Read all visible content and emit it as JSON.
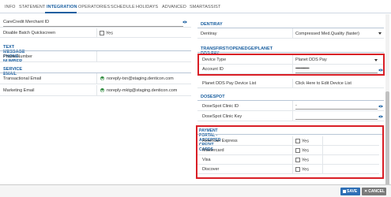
{
  "tabs": [
    {
      "label": "INFO"
    },
    {
      "label": "STATEMENT"
    },
    {
      "label": "INTEGRATION"
    },
    {
      "label": "OPERATORIES"
    },
    {
      "label": "SCHEDULE"
    },
    {
      "label": "HOLIDAYS"
    },
    {
      "label": "ADVANCED"
    },
    {
      "label": "SMARTASSIST"
    }
  ],
  "left": {
    "carecredit_label": "CareCredit Merchant ID",
    "disable_batch_label": "Disable Batch Quickscreen",
    "disable_batch_option": "Yes",
    "text_section_title": "TEXT MESSAGE PHONE NUMBER",
    "phone_label": "Phone Number",
    "email_section_title": "SERVICE EMAIL",
    "transactional_label": "Transactional Email",
    "transactional_value": "noreply-txn@staging.denticon.com",
    "marketing_label": "Marketing Email",
    "marketing_value": "noreply-mktg@staging.denticon.com"
  },
  "right": {
    "dentiray_title": "DENTIRAY",
    "dentiray_label": "Dentiray",
    "dentiray_value": "Compressed Med.Quality (faster)",
    "transfirst_title": "TRANSFIRST/OPENEDGE/PLANET DDS PAY",
    "device_type_label": "Device Type",
    "device_type_value": "Planet DDS Pay",
    "account_id_label": "Account ID",
    "account_id_value": "••••••••••••••••",
    "device_list_label": "Planet DDS Pay Device List",
    "device_list_link": "Click Here to Edit Device List",
    "dosespot_title": "DOSESPOT",
    "clinic_id_label": "DoseSpot Clinic ID",
    "clinic_id_value": "-",
    "clinic_key_label": "DoseSpot Clinic Key",
    "payment_title": "PAYMENT PORTAL - ACCEPTED CREDIT CARDS",
    "cards": [
      {
        "label": "American Express",
        "option": "Yes"
      },
      {
        "label": "Mastercard",
        "option": "Yes"
      },
      {
        "label": "Visa",
        "option": "Yes"
      },
      {
        "label": "Discover",
        "option": "Yes"
      }
    ]
  },
  "footer": {
    "save_label": "SAVE",
    "cancel_label": "CANCEL"
  },
  "colors": {
    "accent": "#1a5fa0",
    "highlight": "#d91f26",
    "success": "#2e8b3e"
  }
}
